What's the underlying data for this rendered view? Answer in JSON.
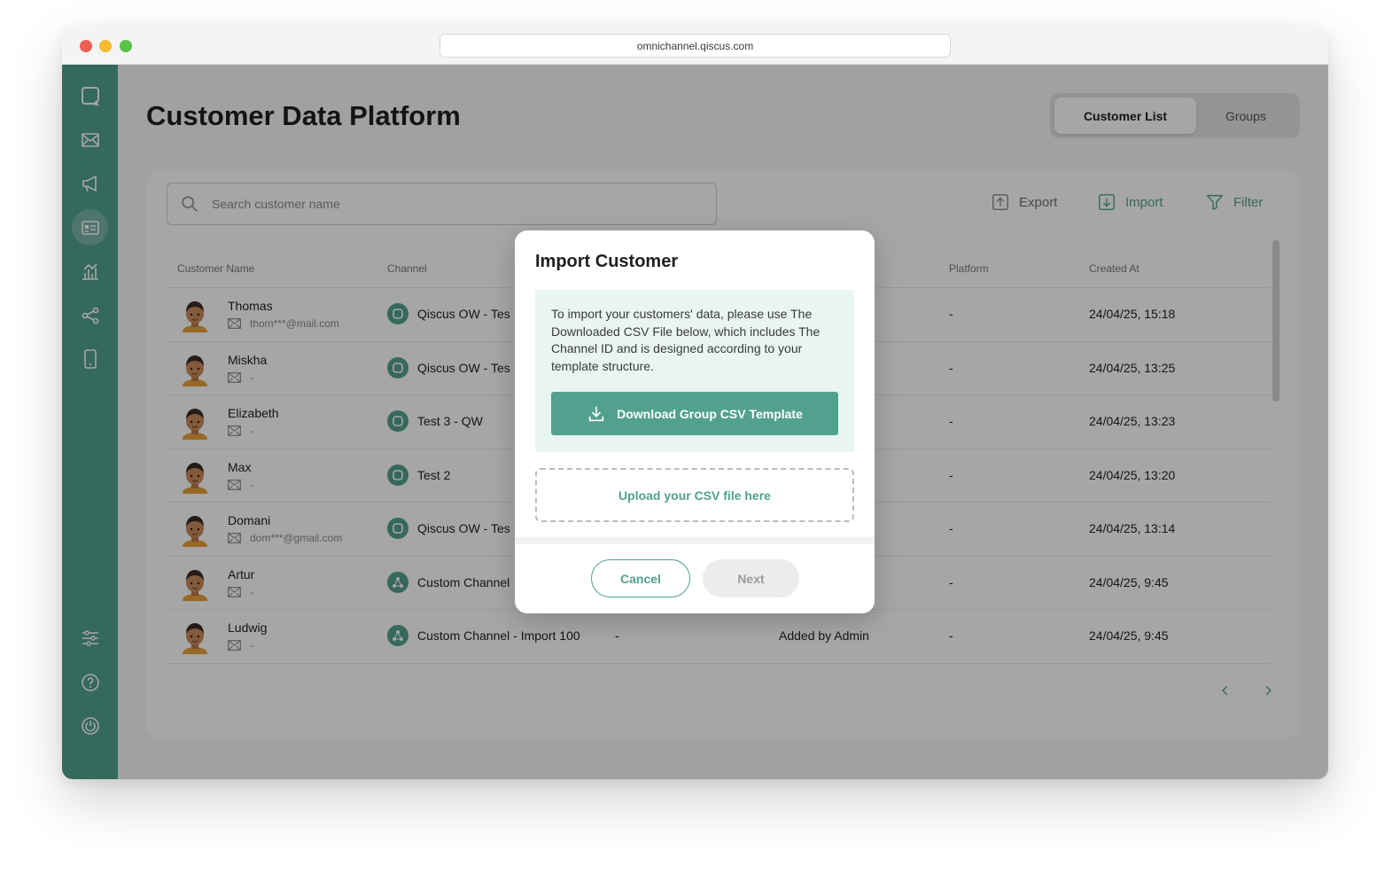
{
  "browser": {
    "url": "omnichannel.qiscus.com"
  },
  "page": {
    "title": "Customer Data Platform"
  },
  "tabs": [
    {
      "label": "Customer List"
    },
    {
      "label": "Groups"
    }
  ],
  "toolbar": {
    "search_placeholder": "Search customer name",
    "export_label": "Export",
    "import_label": "Import",
    "filter_label": "Filter"
  },
  "table": {
    "headers": [
      "Customer Name",
      "Channel",
      "Platform",
      "Created At"
    ],
    "rows": [
      {
        "name": "Thomas",
        "email": "thom***@mail.com",
        "channel": "Qiscus OW - Tes",
        "channel_icon": "chat",
        "platform": "-",
        "created": "24/04/25, 15:18"
      },
      {
        "name": "Miskha",
        "email": "-",
        "channel": "Qiscus OW - Tes",
        "channel_icon": "chat",
        "platform": "-",
        "created": "24/04/25, 13:25"
      },
      {
        "name": "Elizabeth",
        "email": "-",
        "channel": "Test 3 - QW",
        "channel_icon": "chat",
        "platform": "-",
        "created": "24/04/25, 13:23"
      },
      {
        "name": "Max",
        "email": "-",
        "channel": "Test 2",
        "channel_icon": "chat",
        "platform": "-",
        "created": "24/04/25, 13:20"
      },
      {
        "name": "Domani",
        "email": "dom***@gmail.com",
        "channel": "Qiscus OW - Tes",
        "channel_icon": "chat",
        "platform": "-",
        "created": "24/04/25, 13:14"
      },
      {
        "name": "Artur",
        "email": "-",
        "channel": "Custom Channel",
        "channel_icon": "custom",
        "platform": "-",
        "created": "24/04/25, 9:45"
      },
      {
        "name": "Ludwig",
        "email": "-",
        "channel": "Custom Channel - Import 100",
        "channel_icon": "custom",
        "col3": "-",
        "col4": "Added by Admin",
        "platform": "-",
        "created": "24/04/25, 9:45"
      }
    ]
  },
  "modal": {
    "title": "Import Customer",
    "info": "To import your customers' data, please use The Downloaded CSV File below, which includes The Channel ID and is designed according to your template structure.",
    "download_label": "Download Group CSV Template",
    "upload_label": "Upload your CSV file here",
    "cancel_label": "Cancel",
    "next_label": "Next"
  },
  "colors": {
    "brand": "#52a18e",
    "sidebar": "#52a18e",
    "info_bg": "#e9f5f2"
  },
  "icons": {
    "sidebar": [
      "chat-logo-icon",
      "mail-icon",
      "megaphone-icon",
      "contact-card-icon",
      "analytics-icon",
      "share-nodes-icon",
      "mobile-icon",
      "sliders-icon",
      "help-icon",
      "power-icon"
    ]
  }
}
